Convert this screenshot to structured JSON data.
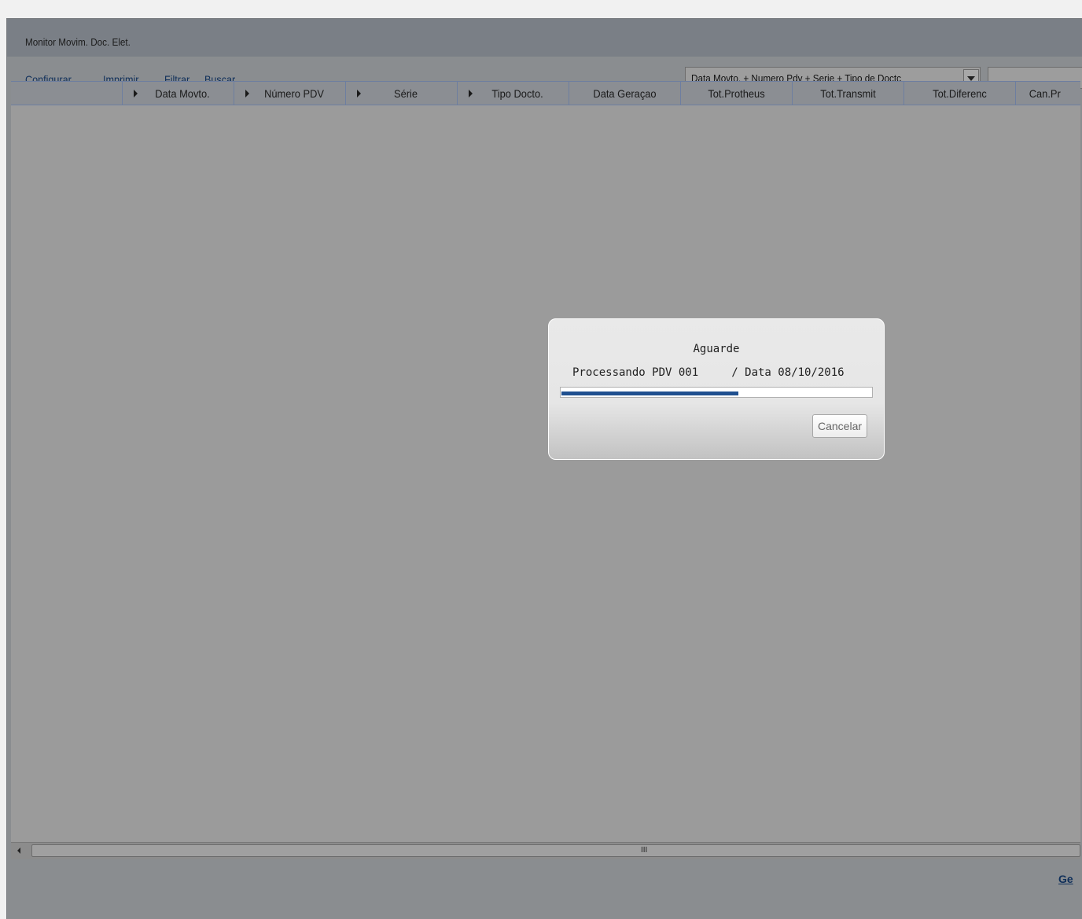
{
  "window": {
    "title": "Monitor Movim. Doc. Elet."
  },
  "toolbar": {
    "links": [
      "Configurar",
      "Imprimir",
      "Filtrar",
      "Buscar"
    ],
    "order_combo": "Data Movto. + Numero Pdv + Serie + Tipo de Doctc",
    "search_value": ""
  },
  "grid": {
    "columns": [
      "",
      "Data Movto.",
      "Número PDV",
      "Série",
      "Tipo Docto.",
      "Data Geraçao",
      "Tot.Protheus",
      "Tot.Transmit",
      "Tot.Diferenc",
      "Can.Pr"
    ]
  },
  "scrollbar": {
    "grip": "III"
  },
  "bottom": {
    "link": "Ge"
  },
  "dialog": {
    "title": "Aguarde",
    "message": "Processando PDV 001     / Data 08/10/2016",
    "progress_percent": 57,
    "cancel_label": "Cancelar"
  }
}
